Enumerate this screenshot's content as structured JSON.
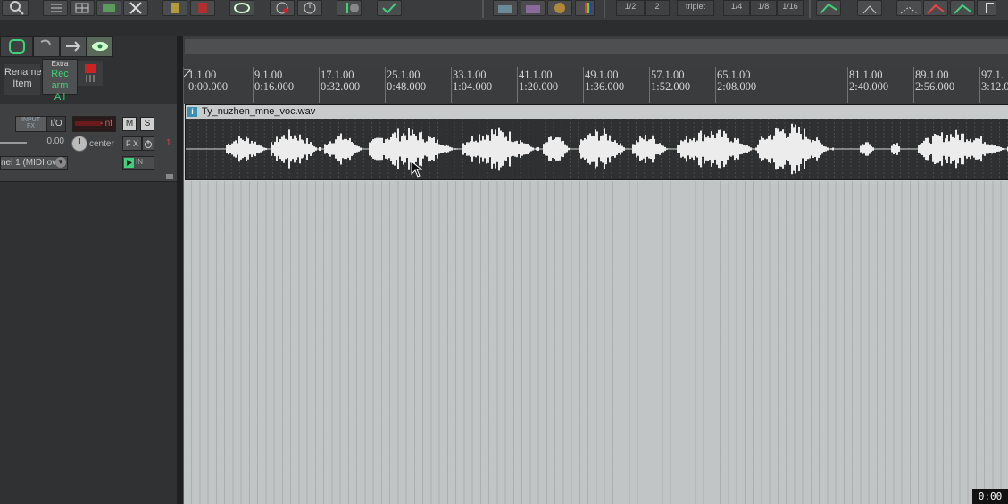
{
  "toolbar": {
    "grid_labels": [
      "1/2",
      "2",
      "triplet",
      "1/4",
      "1/8",
      "1/16"
    ]
  },
  "left_tools": {
    "rename_item": "Rename\nItem",
    "rename_line1": "Rename",
    "rename_line2": "Item",
    "extra_label": "Extra",
    "rec_arm_line1": "Rec arm",
    "rec_arm_line2": "All"
  },
  "track": {
    "number": "1",
    "input_fx_label": "INPUT\nFX",
    "input_line1": "INPUT",
    "input_line2": "FX",
    "io_label": "I/O",
    "volume_readout": "-inf",
    "mute_label": "M",
    "solo_label": "S",
    "volume_value": "0.00",
    "pan_value": "center",
    "fx_label": "F X",
    "midi_input": "nel 1 (MIDI ov",
    "in_label": "IN"
  },
  "ruler": {
    "marks": [
      {
        "beat": "1.1.00",
        "time": "0:00.000"
      },
      {
        "beat": "9.1.00",
        "time": "0:16.000"
      },
      {
        "beat": "17.1.00",
        "time": "0:32.000"
      },
      {
        "beat": "25.1.00",
        "time": "0:48.000"
      },
      {
        "beat": "33.1.00",
        "time": "1:04.000"
      },
      {
        "beat": "41.1.00",
        "time": "1:20.000"
      },
      {
        "beat": "49.1.00",
        "time": "1:36.000"
      },
      {
        "beat": "57.1.00",
        "time": "1:52.000"
      },
      {
        "beat": "65.1.00",
        "time": "2:08.000"
      },
      {
        "beat": "81.1.00",
        "time": "2:40.000"
      },
      {
        "beat": "89.1.00",
        "time": "2:56.000"
      },
      {
        "beat": "97.1.",
        "time": "3:12.0"
      }
    ]
  },
  "item": {
    "name": "Ty_nuzhen_mne_voc.wav",
    "info_icon_letter": "i"
  },
  "status": {
    "clock": "0:00"
  },
  "colors": {
    "accent_green": "#3fd07a",
    "rec_red": "#cc2222",
    "item_info_blue": "#3c8fb4"
  }
}
